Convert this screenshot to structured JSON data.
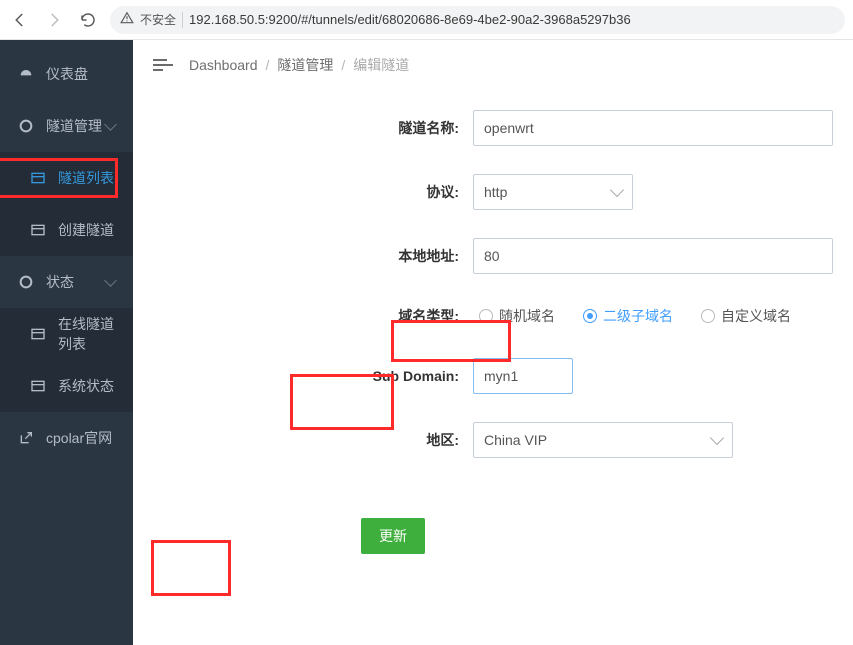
{
  "browser": {
    "insecure_label": "不安全",
    "url": "192.168.50.5:9200/#/tunnels/edit/68020686-8e69-4be2-90a2-3968a5297b36"
  },
  "sidebar": {
    "items": [
      {
        "label": "仪表盘"
      },
      {
        "label": "隧道管理"
      },
      {
        "label": "隧道列表"
      },
      {
        "label": "创建隧道"
      },
      {
        "label": "状态"
      },
      {
        "label": "在线隧道列表"
      },
      {
        "label": "系统状态"
      },
      {
        "label": "cpolar官网"
      }
    ]
  },
  "breadcrumb": {
    "a": "Dashboard",
    "b": "隧道管理",
    "c": "编辑隧道"
  },
  "form": {
    "name_label": "隧道名称:",
    "name_value": "openwrt",
    "proto_label": "协议:",
    "proto_value": "http",
    "localaddr_label": "本地地址:",
    "localaddr_value": "80",
    "domaintype_label": "域名类型:",
    "radios": {
      "random": "随机域名",
      "sub": "二级子域名",
      "custom": "自定义域名"
    },
    "subdomain_label": "Sub Domain:",
    "subdomain_value": "myn1",
    "region_label": "地区:",
    "region_value": "China VIP",
    "submit": "更新"
  }
}
